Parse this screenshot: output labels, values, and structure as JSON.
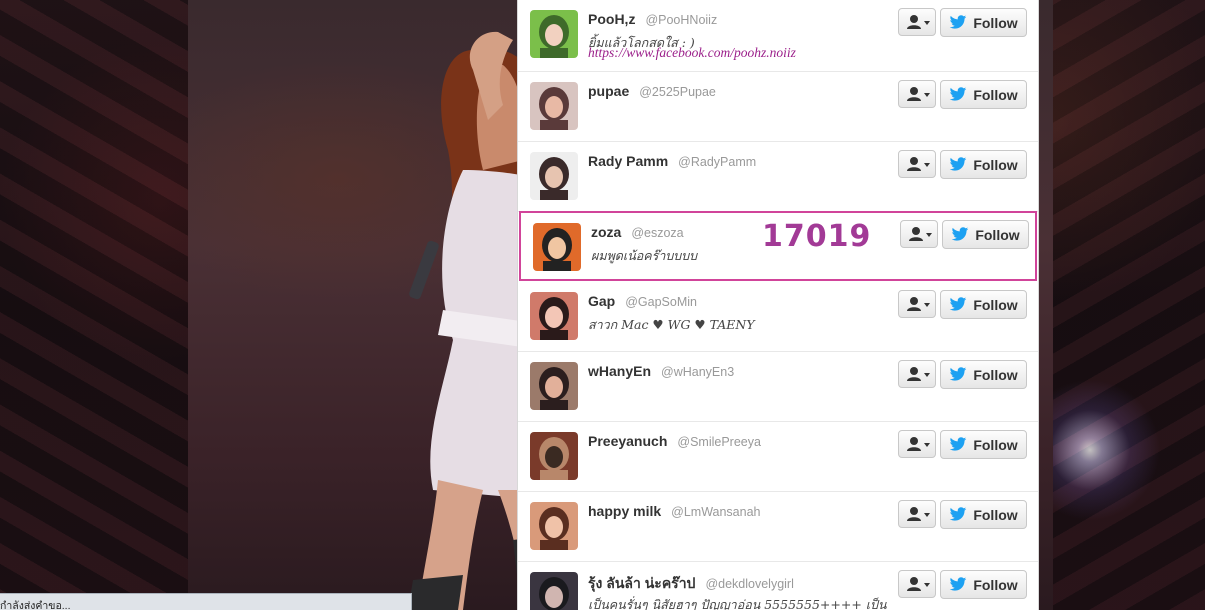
{
  "users": [
    {
      "name": "PooH,z",
      "handle": "@PooHNoiiz",
      "bio": "ยิ้มแล้วโลกสดใส : )",
      "link": "https://www.facebook.com/poohz.noiiz",
      "follow_label": "Follow"
    },
    {
      "name": "pupae",
      "handle": "@2525Pupae",
      "bio": "",
      "follow_label": "Follow"
    },
    {
      "name": "Rady Pamm",
      "handle": "@RadyPamm",
      "bio": "",
      "follow_label": "Follow"
    },
    {
      "name": "zoza",
      "handle": "@eszoza",
      "bio": "ผมพูดเน้อคร๊าบบบบ",
      "follow_label": "Follow"
    },
    {
      "name": "Gap",
      "handle": "@GapSoMin",
      "bio": "สาวก Mac ♥ WG ♥ TAENY",
      "follow_label": "Follow"
    },
    {
      "name": "wHanyEn",
      "handle": "@wHanyEn3",
      "bio": "",
      "follow_label": "Follow"
    },
    {
      "name": "Preeyanuch",
      "handle": "@SmilePreeya",
      "bio": "",
      "follow_label": "Follow"
    },
    {
      "name": "happy milk",
      "handle": "@LmWansanah",
      "bio": "",
      "follow_label": "Follow"
    },
    {
      "name": "รุ้ง ลันล้า น่ะคร๊าป",
      "handle": "@dekdlovelygirl",
      "bio": "เป็นคนรั่นๆ นิสัยฮาๆ ปัญญาอ่อน 5555555++++ เป็น",
      "follow_label": "Follow"
    }
  ],
  "highlight_number": "17019",
  "status_text": "กำลังส่งคำขอ...",
  "icons": {
    "user": "user-dropdown-icon",
    "bird": "twitter-bird-icon"
  },
  "colors": {
    "highlight_border": "#d1449a",
    "highlight_number": "#a23a96",
    "link": "#9b1f8a",
    "bird": "#1da1f2"
  }
}
